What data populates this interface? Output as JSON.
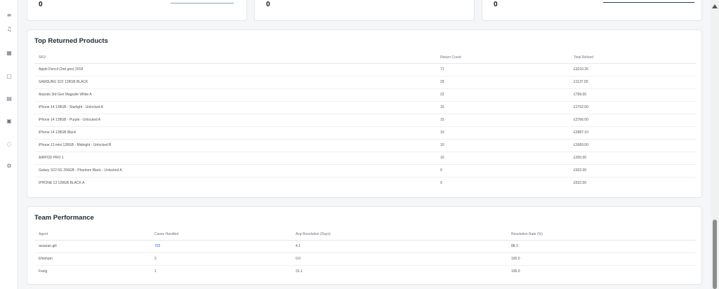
{
  "sidebar": {
    "icons": [
      {
        "name": "menu-icon",
        "glyph": "≡"
      },
      {
        "name": "bell-icon",
        "glyph": "♫"
      },
      {
        "name": "grid-icon",
        "glyph": "▦"
      },
      {
        "name": "box-icon",
        "glyph": "▢"
      },
      {
        "name": "chart-icon",
        "glyph": "▤"
      },
      {
        "name": "document-icon",
        "glyph": "▣"
      },
      {
        "name": "chat-icon",
        "glyph": "◌"
      },
      {
        "name": "settings-icon",
        "glyph": "⚙"
      }
    ]
  },
  "stats": [
    {
      "value": "0"
    },
    {
      "value": "0"
    },
    {
      "value": "0"
    }
  ],
  "top_returned": {
    "title": "Top Returned Products",
    "columns": [
      "SKU",
      "Return Count",
      "Total Refund"
    ],
    "rows": [
      {
        "sku": "Apple Pencil (2nd gen) 2018",
        "count": "71",
        "refund": "£3210.26"
      },
      {
        "sku": "SAMSUNG S22 128GB BLACK",
        "count": "29",
        "refund": "£1137.00"
      },
      {
        "sku": "Airpods 3rd Gen Magsafe White A",
        "count": "22",
        "refund": "£799.00"
      },
      {
        "sku": "iPhone 14 128GB - Starlight - Unlocked A",
        "count": "16",
        "refund": "£1762.00"
      },
      {
        "sku": "iPhone 14 128GB - Purple - Unlocked A",
        "count": "15",
        "refund": "£2766.00"
      },
      {
        "sku": "iPhone 14 128GB Black",
        "count": "10",
        "refund": "£2887.10"
      },
      {
        "sku": "iPhone 13 mini 128GB - Midnight - Unlocked B",
        "count": "10",
        "refund": "£1669.00"
      },
      {
        "sku": "AIRPOD PRO 1",
        "count": "10",
        "refund": "£200.00"
      },
      {
        "sku": "Galaxy S22 5G 256GB - Phantom Black - Unlocked A",
        "count": "9",
        "refund": "£932.00"
      },
      {
        "sku": "IPHONE 13 128GB BLACK A",
        "count": "9",
        "refund": "£632.00"
      }
    ]
  },
  "team": {
    "title": "Team Performance",
    "columns": [
      "Agent",
      "Cases Handled",
      "Avg Resolution (Days)",
      "Resolution Rate (%)"
    ],
    "rows": [
      {
        "agent": "ansaran.gill",
        "cases": "702",
        "avg": "4.1",
        "rate": "88.3"
      },
      {
        "agent": "Ehtsham",
        "cases": "2",
        "avg": "0.0",
        "rate": "100.0"
      },
      {
        "agent": "Fasig",
        "cases": "1",
        "avg": "31.1",
        "rate": "100.0"
      }
    ]
  }
}
